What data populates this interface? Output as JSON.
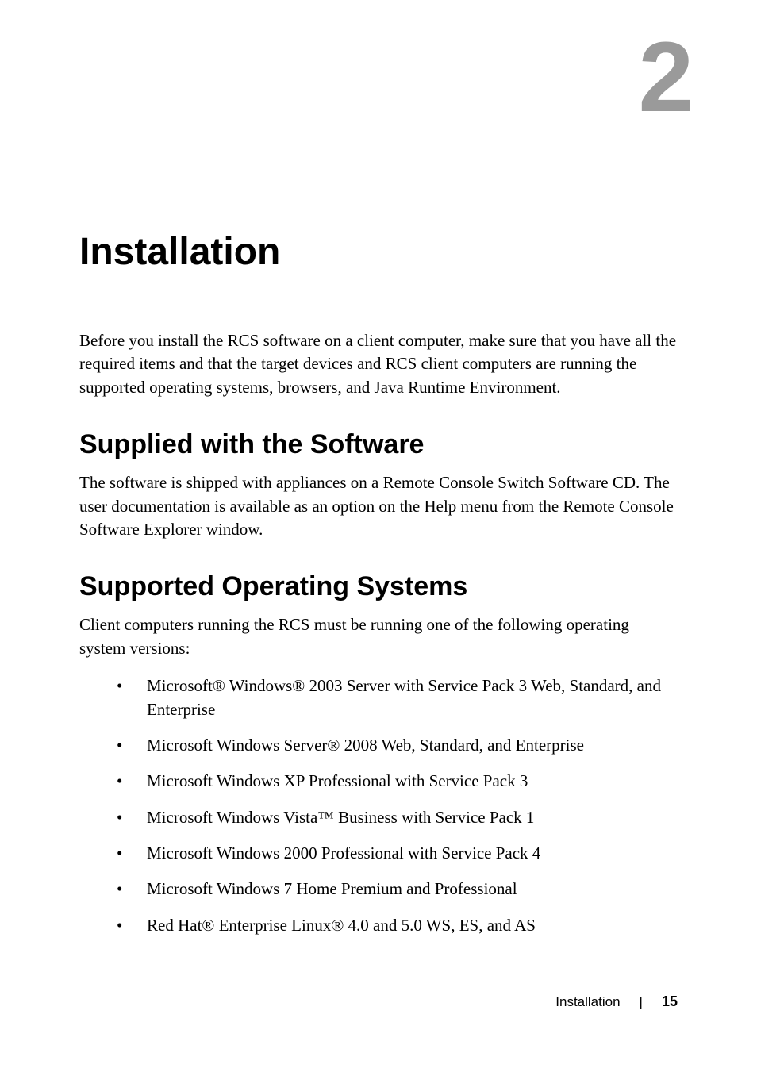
{
  "chapter_number": "2",
  "title": "Installation",
  "intro_paragraph": "Before you install the RCS software on a client computer, make sure that you have all the required items and that the target devices and RCS client computers are running the supported operating systems, browsers, and Java Runtime Environment.",
  "section1": {
    "heading": "Supplied with the Software",
    "paragraph": "The software is shipped with appliances on a Remote Console Switch Software CD. The user documentation is available as an option on the Help menu from the Remote Console Software Explorer window."
  },
  "section2": {
    "heading": "Supported Operating Systems",
    "intro": "Client computers running the RCS must be running one of the following operating system versions:",
    "items": [
      "Microsoft® Windows® 2003 Server with Service Pack 3 Web, Standard, and Enterprise",
      "Microsoft Windows Server® 2008 Web, Standard, and Enterprise",
      "Microsoft Windows XP Professional with Service Pack 3",
      "Microsoft Windows Vista™ Business with Service Pack 1",
      "Microsoft Windows 2000 Professional with Service Pack 4",
      "Microsoft Windows 7 Home Premium and Professional",
      "Red Hat® Enterprise Linux® 4.0 and 5.0 WS, ES, and AS"
    ]
  },
  "footer": {
    "label": "Installation",
    "separator": "|",
    "page_number": "15"
  }
}
